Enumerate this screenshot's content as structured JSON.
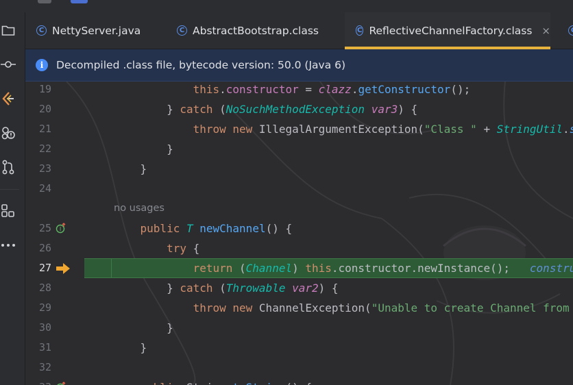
{
  "tabs": [
    {
      "label": "NettyServer.java",
      "icon": "class-icon",
      "active": false
    },
    {
      "label": "AbstractBootstrap.class",
      "icon": "class-icon",
      "active": false
    },
    {
      "label": "ReflectiveChannelFactory.class",
      "icon": "class-icon",
      "active": true
    }
  ],
  "tab_close_glyph": "×",
  "banner": {
    "icon": "info-icon",
    "text": "Decompiled .class file, bytecode version: 50.0 (Java 6)"
  },
  "toolbar": [
    "project-icon",
    "commit-icon",
    "build-icon",
    "structure-icon",
    "pull-requests-icon",
    "plugins-icon",
    "more-icon"
  ],
  "editor": {
    "current_line": "27",
    "no_usages_text": "no usages",
    "lines": [
      {
        "n": "19",
        "tokens": [
          [
            "            ",
            ""
          ],
          [
            "this",
            "kw"
          ],
          [
            ".",
            ""
          ],
          [
            "constructor",
            "fld"
          ],
          [
            " = ",
            ""
          ],
          [
            "clazz",
            "fldi"
          ],
          [
            ".",
            ""
          ],
          [
            "getConstructor",
            "fn"
          ],
          [
            "();",
            ""
          ]
        ]
      },
      {
        "n": "20",
        "tokens": [
          [
            "        } ",
            ""
          ],
          [
            "catch",
            "kw"
          ],
          [
            " (",
            ""
          ],
          [
            "NoSuchMethodException",
            "typ"
          ],
          [
            " ",
            ""
          ],
          [
            "var3",
            "loc"
          ],
          [
            ") {",
            ""
          ]
        ]
      },
      {
        "n": "21",
        "tokens": [
          [
            "            ",
            ""
          ],
          [
            "throw new ",
            "kw"
          ],
          [
            "IllegalArgumentException",
            "cls"
          ],
          [
            "(",
            ""
          ],
          [
            "\"Class \"",
            "str"
          ],
          [
            " + ",
            ""
          ],
          [
            "StringUtil",
            "typ"
          ],
          [
            ".",
            ""
          ],
          [
            "si",
            "smeth"
          ]
        ]
      },
      {
        "n": "22",
        "tokens": [
          [
            "        }",
            ""
          ]
        ]
      },
      {
        "n": "23",
        "tokens": [
          [
            "    }",
            ""
          ]
        ]
      },
      {
        "n": "24",
        "tokens": []
      },
      {
        "n": "25",
        "tokens": [
          [
            "    ",
            ""
          ],
          [
            "public ",
            "kw"
          ],
          [
            "T",
            "tp"
          ],
          [
            " ",
            ""
          ],
          [
            "newChannel",
            "fn"
          ],
          [
            "() {",
            ""
          ]
        ]
      },
      {
        "n": "26",
        "tokens": [
          [
            "        ",
            ""
          ],
          [
            "try",
            "kw"
          ],
          [
            " {",
            ""
          ]
        ]
      },
      {
        "n": "27",
        "tokens": [
          [
            "            ",
            ""
          ],
          [
            "return",
            "kw"
          ],
          [
            " (",
            ""
          ],
          [
            "Channel",
            "typ"
          ],
          [
            ") ",
            ""
          ],
          [
            "this",
            "kw"
          ],
          [
            ".",
            ""
          ],
          [
            "constructor",
            "method"
          ],
          [
            ".",
            ""
          ],
          [
            "newInstance",
            "method"
          ],
          [
            "();",
            ""
          ]
        ],
        "inline_comment": "construct"
      },
      {
        "n": "28",
        "tokens": [
          [
            "        } ",
            ""
          ],
          [
            "catch",
            "kw"
          ],
          [
            " (",
            ""
          ],
          [
            "Throwable",
            "typ"
          ],
          [
            " ",
            ""
          ],
          [
            "var2",
            "loc"
          ],
          [
            ") {",
            ""
          ]
        ]
      },
      {
        "n": "29",
        "tokens": [
          [
            "            ",
            ""
          ],
          [
            "throw new ",
            "kw"
          ],
          [
            "ChannelException",
            "cls"
          ],
          [
            "(",
            ""
          ],
          [
            "\"Unable to create Channel from c",
            "str"
          ]
        ]
      },
      {
        "n": "30",
        "tokens": [
          [
            "        }",
            ""
          ]
        ]
      },
      {
        "n": "31",
        "tokens": [
          [
            "    }",
            ""
          ]
        ]
      },
      {
        "n": "32",
        "tokens": []
      },
      {
        "n": "33",
        "tokens": [
          [
            "    ",
            ""
          ],
          [
            "public ",
            "kw"
          ],
          [
            "String",
            "cls"
          ],
          [
            " ",
            ""
          ],
          [
            "toString",
            "fn"
          ],
          [
            "() {",
            ""
          ]
        ]
      }
    ]
  }
}
